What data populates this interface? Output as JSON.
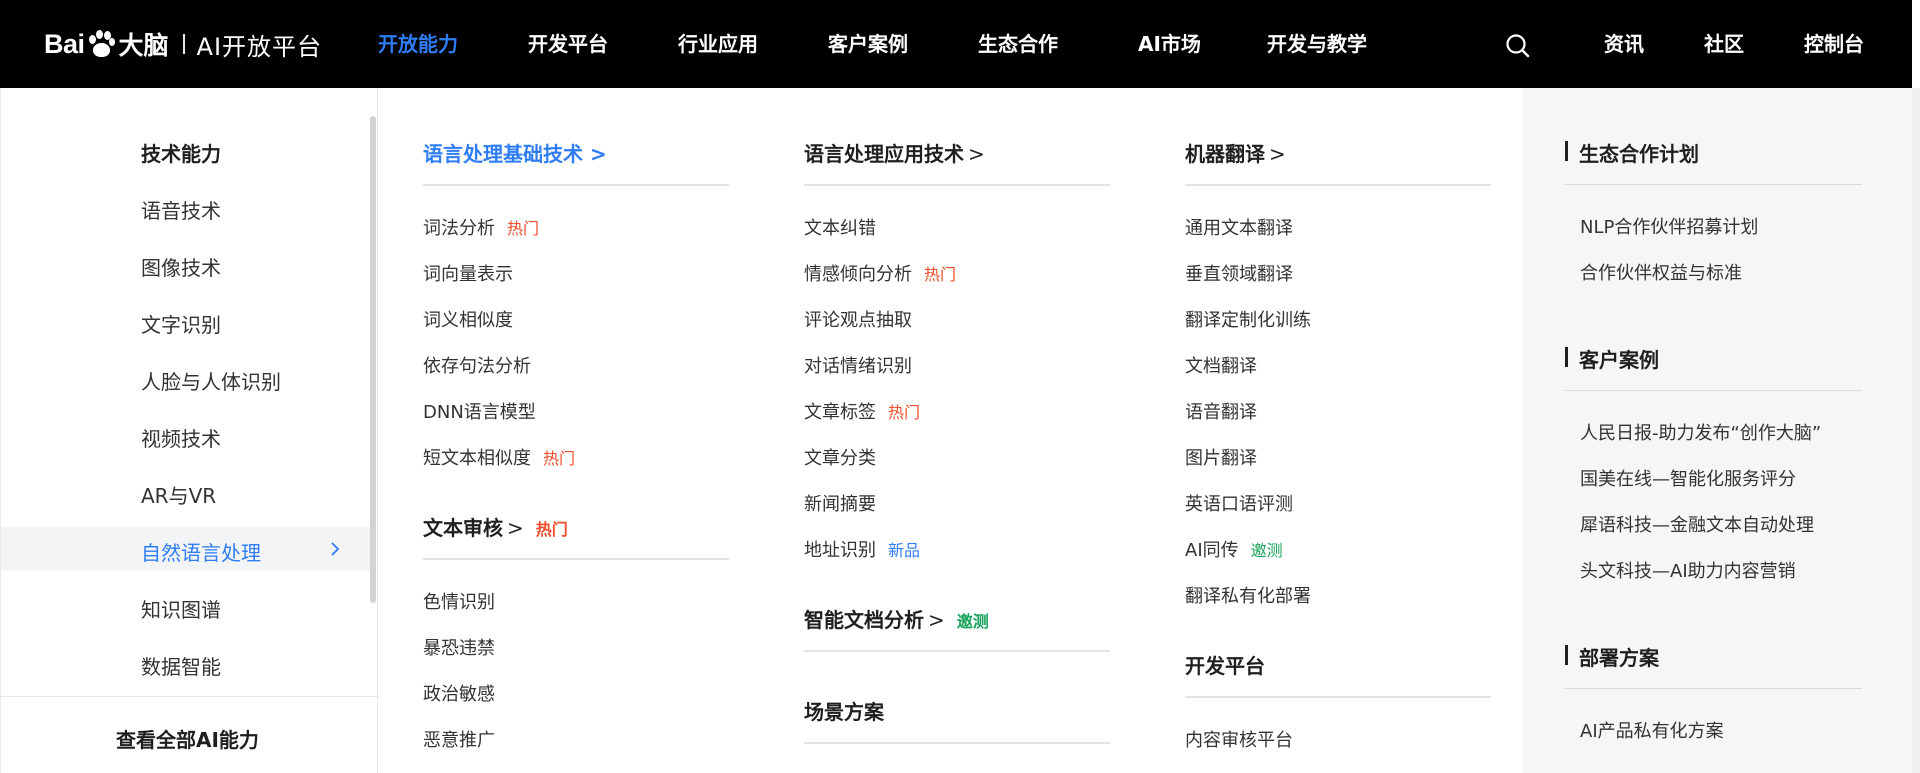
{
  "brand": {
    "baidu": "Bai",
    "du": "du",
    "dana": "大脑",
    "platform": "AI开放平台"
  },
  "nav": {
    "items": [
      "开放能力",
      "开发平台",
      "行业应用",
      "客户案例",
      "生态合作",
      "AI市场",
      "开发与教学"
    ],
    "right": [
      "资讯",
      "社区",
      "控制台"
    ],
    "active_color": "#2e7df6"
  },
  "left": {
    "title": "技术能力",
    "items": [
      "语音技术",
      "图像技术",
      "文字识别",
      "人脸与人体识别",
      "视频技术",
      "AR与VR",
      "自然语言处理",
      "知识图谱",
      "数据智能"
    ],
    "active": "自然语言处理",
    "view_all": "查看全部AI能力"
  },
  "col1": {
    "head1": "语言处理基础技术 >",
    "links1": [
      "词法分析",
      "词向量表示",
      "词义相似度",
      "依存句法分析",
      "DNN语言模型",
      "短文本相似度"
    ],
    "tag_hot": "热门",
    "head2": "文本审核",
    "head2_arrow": ">",
    "links2": [
      "色情识别",
      "暴恐违禁",
      "政治敏感",
      "恶意推广"
    ]
  },
  "col2": {
    "head1": "语言处理应用技术",
    "head1_arrow": ">",
    "links1": [
      "文本纠错",
      "情感倾向分析",
      "评论观点抽取",
      "对话情绪识别",
      "文章标签",
      "文章分类",
      "新闻摘要",
      "地址识别"
    ],
    "tag_new": "新品",
    "head2": "智能文档分析",
    "head2_arrow": ">",
    "tag_invite": "邀测",
    "head3": "场景方案"
  },
  "col3": {
    "head1": "机器翻译",
    "head1_arrow": ">",
    "links1": [
      "通用文本翻译",
      "垂直领域翻译",
      "翻译定制化训练",
      "文档翻译",
      "语音翻译",
      "图片翻译",
      "英语口语评测",
      "AI同传",
      "翻译私有化部署"
    ],
    "head2": "开发平台",
    "links2": [
      "内容审核平台"
    ]
  },
  "right": {
    "head1": "生态合作计划",
    "links1": [
      "NLP合作伙伴招募计划",
      "合作伙伴权益与标准"
    ],
    "head2": "客户案例",
    "links2": [
      "人民日报-助力发布“创作大脑”",
      "国美在线—智能化服务评分",
      "犀语科技—金融文本自动处理",
      "头文科技—AI助力内容营销"
    ],
    "head3": "部署方案",
    "links3": [
      "AI产品私有化方案"
    ]
  }
}
